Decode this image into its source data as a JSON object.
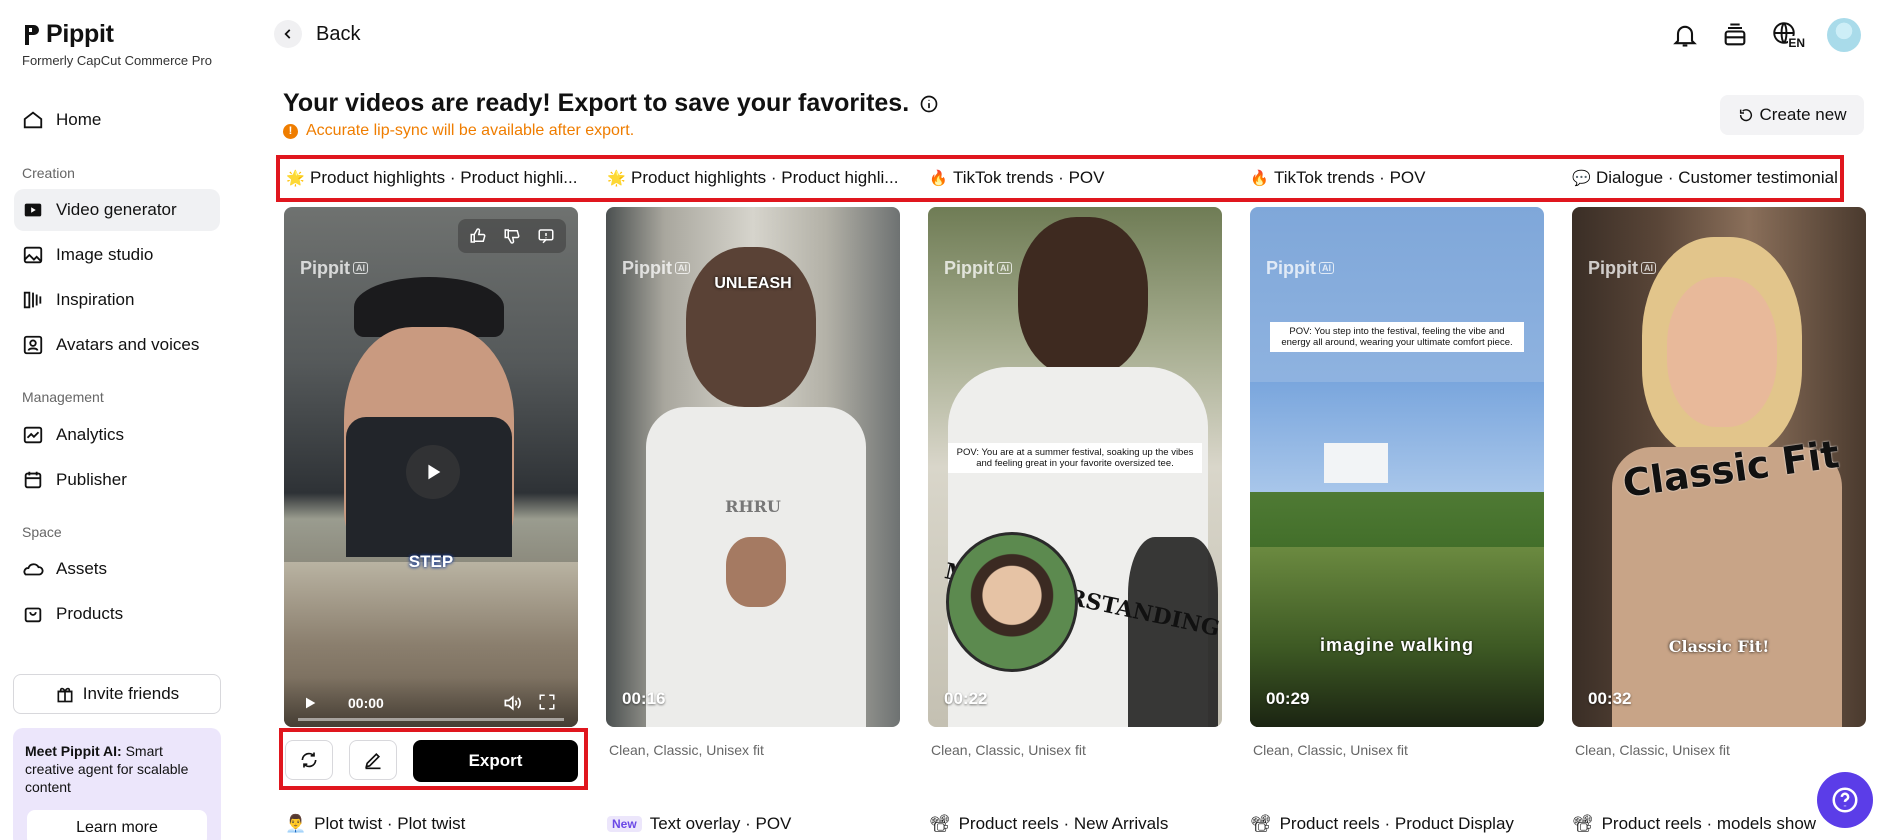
{
  "brand": {
    "name": "Pippit",
    "subtitle": "Formerly CapCut Commerce Pro"
  },
  "sidebar": {
    "items": [
      {
        "label": "Home",
        "icon": "home-icon"
      },
      {
        "label": "Video generator",
        "icon": "video-generator-icon",
        "active": true
      },
      {
        "label": "Image studio",
        "icon": "image-icon"
      },
      {
        "label": "Inspiration",
        "icon": "inspiration-icon"
      },
      {
        "label": "Avatars and voices",
        "icon": "avatar-icon"
      },
      {
        "label": "Analytics",
        "icon": "analytics-icon"
      },
      {
        "label": "Publisher",
        "icon": "calendar-icon"
      },
      {
        "label": "Assets",
        "icon": "cloud-icon"
      },
      {
        "label": "Products",
        "icon": "bag-icon"
      }
    ],
    "sections": [
      "Creation",
      "Management",
      "Space"
    ],
    "invite_label": "Invite friends",
    "promo": {
      "title": "Meet Pippit AI:",
      "text": " Smart creative agent for scalable content",
      "button": "Learn more"
    }
  },
  "header": {
    "back_label": "Back",
    "language": "EN"
  },
  "main": {
    "title": "Your videos are ready! Export to save your favorites.",
    "notice": "Accurate lip-sync will be available after export.",
    "create_new_label": "Create new",
    "categories": [
      {
        "emoji": "🌟",
        "label": "Product highlights · Product highli..."
      },
      {
        "emoji": "🌟",
        "label": "Product highlights · Product highli..."
      },
      {
        "emoji": "🔥",
        "label": "TikTok trends · POV"
      },
      {
        "emoji": "🔥",
        "label": "TikTok trends · POV"
      },
      {
        "emoji": "💬",
        "label": "Dialogue · Customer testimonial"
      }
    ],
    "cards": [
      {
        "duration": "00:00",
        "tags": "",
        "overlay": "STEP"
      },
      {
        "duration": "00:16",
        "tags": "Clean, Classic, Unisex fit",
        "overlay": "UNLEASH"
      },
      {
        "duration": "00:22",
        "tags": "Clean, Classic, Unisex fit",
        "overlay": "POV: You are at a summer festival, soaking up the vibes and feeling great in your favorite oversized tee."
      },
      {
        "duration": "00:29",
        "tags": "Clean, Classic, Unisex fit",
        "overlay": "POV: You step into the festival, feeling the vibe and energy all around, wearing your ultimate comfort piece.",
        "overlay2": "imagine walking"
      },
      {
        "duration": "00:32",
        "tags": "Clean, Classic, Unisex fit",
        "overlay": "Classic Fit",
        "overlay2": "Classic Fit!"
      }
    ],
    "watermark": "Pippit",
    "watermark_badge": "AI",
    "card2_shirt_text": "RHRU",
    "card3_shirt_text": "MISUNDERSTANDING",
    "export_label": "Export",
    "bottom_categories": [
      {
        "emoji": "👨‍💼",
        "label": "Plot twist · Plot twist"
      },
      {
        "badge": "New",
        "label": "Text overlay · POV"
      },
      {
        "emoji": "📽",
        "label": "Product reels · New Arrivals"
      },
      {
        "emoji": "📽",
        "label": "Product reels · Product Display"
      },
      {
        "emoji": "📽",
        "label": "Product reels · models show"
      }
    ]
  },
  "colors": {
    "accent": "#5b3de8",
    "highlight": "#e0161e",
    "warning": "#ef7d00"
  }
}
